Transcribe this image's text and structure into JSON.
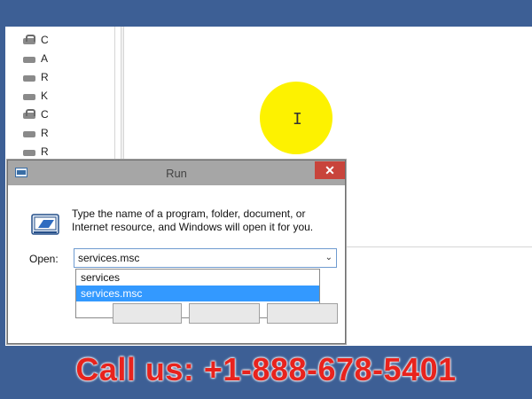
{
  "background": {
    "left_items": [
      {
        "label": "C",
        "icon": "drive-icon"
      },
      {
        "label": "A",
        "icon": "drive-icon"
      },
      {
        "label": "R",
        "icon": "drive-icon"
      },
      {
        "label": "K",
        "icon": "drive-icon"
      },
      {
        "label": "C",
        "icon": "drive-icon"
      },
      {
        "label": "R",
        "icon": "drive-icon"
      },
      {
        "label": "R",
        "icon": "drive-icon"
      }
    ]
  },
  "cursor": {
    "glyph": "I",
    "highlight_color": "#fdf200"
  },
  "run_dialog": {
    "title": "Run",
    "close_glyph": "✕",
    "message": "Type the name of a program, folder, document, or Internet resource, and Windows will open it for you.",
    "open_label": "Open:",
    "input_value": "services.msc",
    "dropdown_glyph": "⌄",
    "suggestions": [
      {
        "label": "services",
        "selected": false
      },
      {
        "label": "services.msc",
        "selected": true
      }
    ]
  },
  "banner": {
    "text": "Call us: +1-888-678-5401",
    "color": "#e8231d",
    "band_color": "#3d5f95"
  }
}
